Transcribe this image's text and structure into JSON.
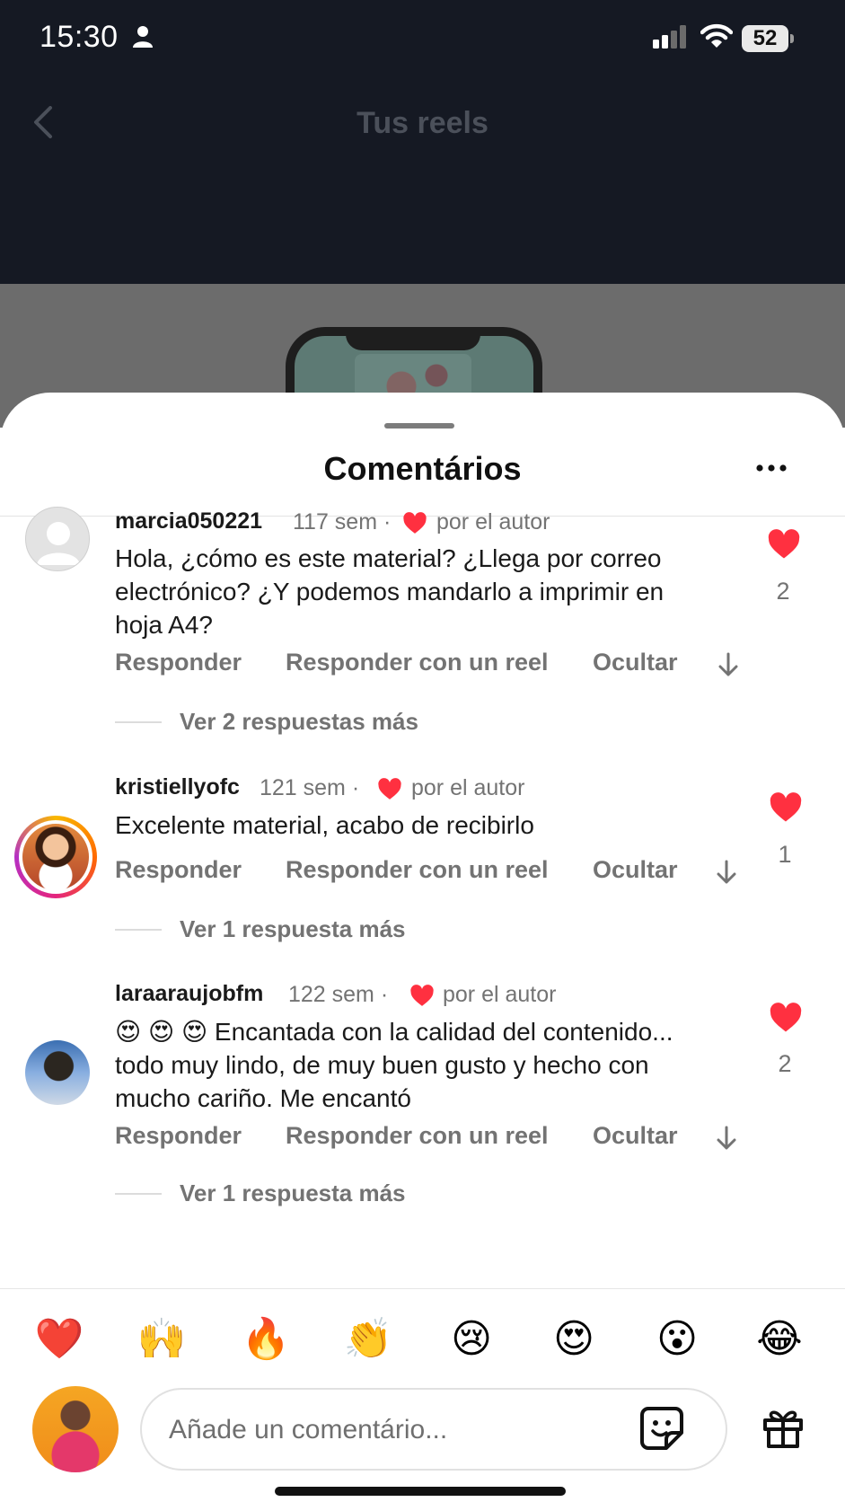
{
  "status_bar": {
    "time": "15:30",
    "battery": "52"
  },
  "screen": {
    "title": "Tus reels"
  },
  "sheet": {
    "title": "Comentários"
  },
  "comments": [
    {
      "username": "marcia050221",
      "meta": "117 sem ·",
      "author_like": "por el autor",
      "text": "Hola, ¿cómo es este material? ¿Llega por correo electrónico? ¿Y podemos mandarlo a imprimir en hoja A4?",
      "actions": {
        "reply": "Responder",
        "reply_reel": "Responder con un reel",
        "hide": "Ocultar"
      },
      "likes": "2",
      "replies": "Ver 2 respuestas más"
    },
    {
      "username": "kristiellyofc",
      "meta": "121 sem ·",
      "author_like": "por el autor",
      "text": "Excelente material, acabo de recibirlo",
      "actions": {
        "reply": "Responder",
        "reply_reel": "Responder con un reel",
        "hide": "Ocultar"
      },
      "likes": "1",
      "replies": "Ver 1 respuesta más"
    },
    {
      "username": "laraaraujobfm",
      "meta": "122 sem ·",
      "author_like": "por el autor",
      "text": "😍 😍 😍 Encantada con la calidad del contenido... todo muy lindo, de muy buen gusto y hecho con mucho cariño. Me encantó",
      "actions": {
        "reply": "Responder",
        "reply_reel": "Responder con un reel",
        "hide": "Ocultar"
      },
      "likes": "2",
      "replies": "Ver 1 respuesta más"
    }
  ],
  "quick_reactions": [
    "❤️",
    "🙌",
    "🔥",
    "👏",
    "😢",
    "😍",
    "😮",
    "😂"
  ],
  "composer": {
    "placeholder": "Añade un comentário..."
  },
  "colors": {
    "like_red": "#ff3040",
    "muted_text": "#737373",
    "header_bg": "#151923"
  }
}
